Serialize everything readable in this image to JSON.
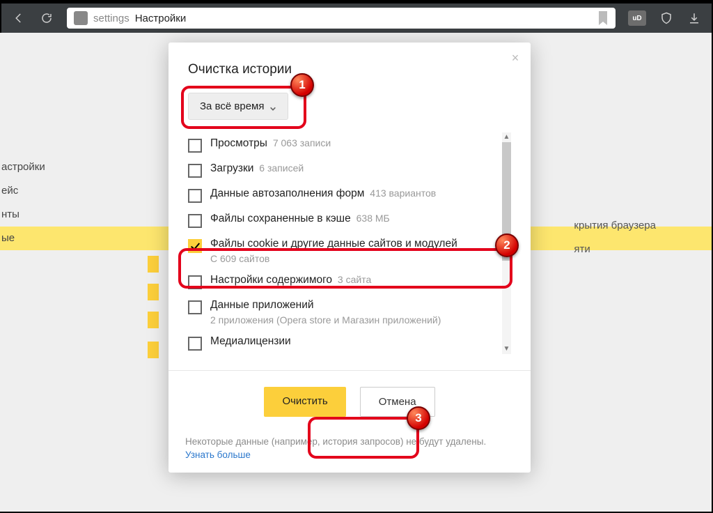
{
  "toolbar": {
    "address_key": "settings",
    "address_title": "Настройки",
    "ext_label": "uD"
  },
  "behind": {
    "side": [
      "астройки",
      "ейс",
      "нты",
      "ые"
    ],
    "right": [
      "крытия браузера",
      "яти"
    ],
    "more": "Узнать больше"
  },
  "dialog": {
    "title": "Очистка истории",
    "period": "За всё время",
    "options": [
      {
        "label": "Просмотры",
        "sub": "7 063 записи",
        "inline": true,
        "checked": false
      },
      {
        "label": "Загрузки",
        "sub": "6 записей",
        "inline": true,
        "checked": false
      },
      {
        "label": "Данные автозаполнения форм",
        "sub": "413 вариантов",
        "inline": true,
        "checked": false
      },
      {
        "label": "Файлы сохраненные в кэше",
        "sub": "638 МБ",
        "inline": true,
        "checked": false
      },
      {
        "label": "Файлы cookie и другие данные сайтов и модулей",
        "sub": "С 609 сайтов",
        "inline": false,
        "checked": true
      },
      {
        "label": "Настройки содержимого",
        "sub": "3 сайта",
        "inline": true,
        "checked": false
      },
      {
        "label": "Данные приложений",
        "sub": "2 приложения (Opera store и Магазин приложений)",
        "inline": false,
        "checked": false
      },
      {
        "label": "Медиалицензии",
        "sub": "",
        "inline": true,
        "checked": false
      }
    ],
    "primary": "Очистить",
    "secondary": "Отмена",
    "footer_note": "Некоторые данные (например, история запросов) не будут удалены.",
    "footer_link": "Узнать больше"
  },
  "annotations": {
    "b1": "1",
    "b2": "2",
    "b3": "3"
  }
}
